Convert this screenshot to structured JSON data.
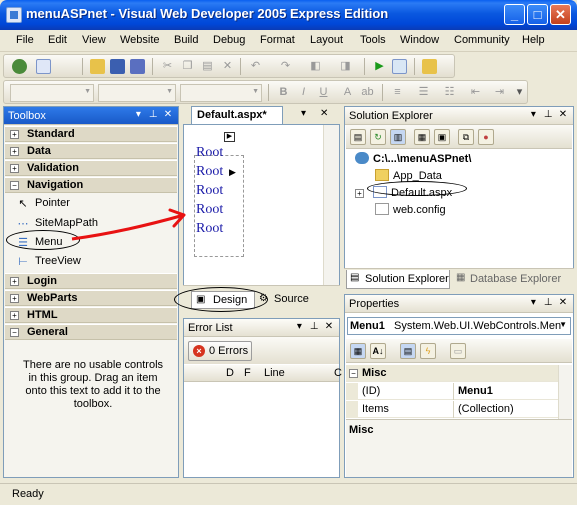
{
  "window": {
    "title": "menuASPnet - Visual Web Developer 2005 Express Edition",
    "minimize": "_",
    "maximize": "□",
    "close": "✕"
  },
  "menubar": [
    "File",
    "Edit",
    "View",
    "Website",
    "Build",
    "Debug",
    "Format",
    "Layout",
    "Tools",
    "Window",
    "Community",
    "Help"
  ],
  "toolbar2": {
    "bold": "B",
    "italic": "I",
    "underline": "U",
    "dropdown": "▾"
  },
  "panel_controls": {
    "dropdown": "▾",
    "pin": "⊥",
    "close": "✕"
  },
  "toolbox": {
    "title": "Toolbox",
    "categories_top": [
      "Standard",
      "Data",
      "Validation"
    ],
    "navigation": {
      "label": "Navigation",
      "items": [
        {
          "label": "Pointer",
          "icon": "pointer-icon"
        },
        {
          "label": "SiteMapPath",
          "icon": "sitemappath-icon"
        },
        {
          "label": "Menu",
          "icon": "menu-control-icon"
        },
        {
          "label": "TreeView",
          "icon": "treeview-icon"
        }
      ]
    },
    "categories_bottom": [
      "Login",
      "WebParts",
      "HTML",
      "General"
    ],
    "empty_message": "There are no usable controls in this group. Drag an item onto this text to add it to the toolbox."
  },
  "designer": {
    "tab": "Default.aspx*",
    "root_items": [
      "Root",
      "Root",
      "Root",
      "Root",
      "Root"
    ],
    "view_tabs": {
      "design": "Design",
      "source": "Source"
    }
  },
  "error_list": {
    "title": "Error List",
    "errors_button": "0 Errors",
    "columns": [
      "D",
      "F",
      "Line",
      "C"
    ]
  },
  "solution_explorer": {
    "title": "Solution Explorer",
    "root": "C:\\...\\menuASPnet\\",
    "items": [
      "App_Data",
      "Default.aspx",
      "web.config"
    ],
    "tabs": [
      "Solution Explorer",
      "Database Explorer"
    ]
  },
  "properties": {
    "title": "Properties",
    "object_name": "Menu1",
    "object_type": "System.Web.UI.WebControls.Men",
    "category": "Misc",
    "rows": [
      {
        "name": "(ID)",
        "value": "Menu1"
      },
      {
        "name": "Items",
        "value": "(Collection)"
      }
    ],
    "description_title": "Misc"
  },
  "status": {
    "text": "Ready"
  },
  "colors": {
    "title_bar": "#0a58e0",
    "annotation_arrow": "#e81212",
    "root_link": "#1a1aa8"
  }
}
